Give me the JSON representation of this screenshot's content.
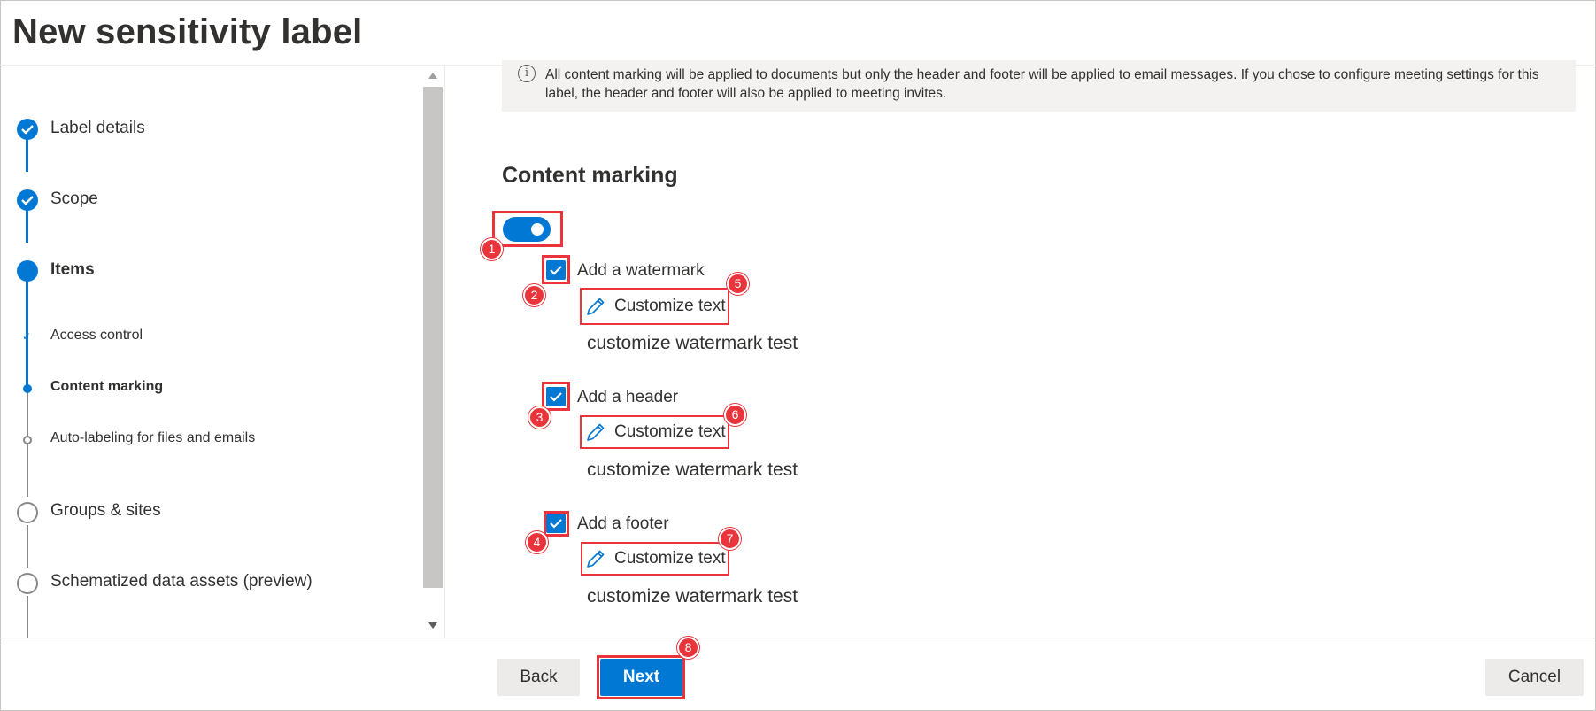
{
  "header": {
    "title": "New sensitivity label"
  },
  "nav": {
    "steps": [
      {
        "label": "Label details",
        "state": "done"
      },
      {
        "label": "Scope",
        "state": "done"
      },
      {
        "label": "Items",
        "state": "current"
      },
      {
        "label": "Groups & sites",
        "state": "pending"
      },
      {
        "label": "Schematized data assets (preview)",
        "state": "pending"
      }
    ],
    "substeps": [
      {
        "label": "Access control",
        "state": "done"
      },
      {
        "label": "Content marking",
        "state": "current"
      },
      {
        "label": "Auto-labeling for files and emails",
        "state": "pending"
      }
    ]
  },
  "info": {
    "icon": "info-icon",
    "text": "All content marking will be applied to documents but only the header and footer will be applied to email messages. If you chose to configure meeting settings for this label, the header and footer will also be applied to meeting invites."
  },
  "content_marking": {
    "title": "Content marking",
    "toggle_on": true,
    "options": [
      {
        "label": "Add a watermark",
        "checked": true,
        "customize_label": "Customize text",
        "value": "customize watermark test"
      },
      {
        "label": "Add a header",
        "checked": true,
        "customize_label": "Customize text",
        "value": "customize watermark test"
      },
      {
        "label": "Add a footer",
        "checked": true,
        "customize_label": "Customize text",
        "value": "customize watermark test"
      }
    ]
  },
  "annotations": [
    "1",
    "2",
    "3",
    "4",
    "5",
    "6",
    "7",
    "8"
  ],
  "footer": {
    "back_label": "Back",
    "next_label": "Next",
    "cancel_label": "Cancel"
  },
  "colors": {
    "accent": "#0078d4",
    "highlight": "#e8343a"
  }
}
